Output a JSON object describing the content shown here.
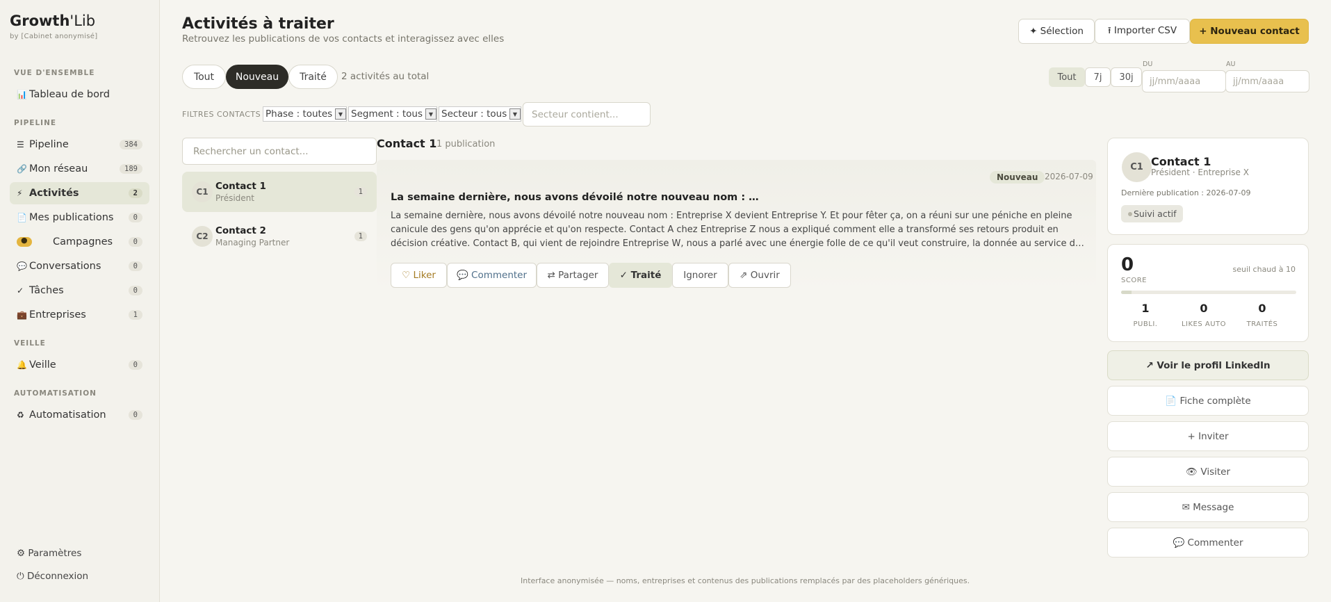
{
  "brand": {
    "name_bold": "Growth",
    "name_rest": "'Lib",
    "sub": "by [Cabinet anonymisé]"
  },
  "sidebar": {
    "sections": [
      "VUE D'ENSEMBLE",
      "PIPELINE",
      "VEILLE",
      "AUTOMATISATION"
    ],
    "items": [
      {
        "icon": "📊",
        "label": "Tableau de bord",
        "count": ""
      },
      {
        "icon": "☰",
        "label": "Pipeline",
        "count": "384"
      },
      {
        "icon": "🔗",
        "label": "Mon réseau",
        "count": "189"
      },
      {
        "icon": "⚡",
        "label": "Activités",
        "count": "2"
      },
      {
        "icon": "📄",
        "label": "Mes publications",
        "count": "0"
      },
      {
        "icon": "●",
        "label": "Campagnes",
        "count": "0"
      },
      {
        "icon": "💬",
        "label": "Conversations",
        "count": "0"
      },
      {
        "icon": "✓",
        "label": "Tâches",
        "count": "0"
      },
      {
        "icon": "💼",
        "label": "Entreprises",
        "count": "1"
      },
      {
        "icon": "🔔",
        "label": "Veille",
        "count": "0"
      },
      {
        "icon": "♻",
        "label": "Automatisation",
        "count": "0"
      }
    ],
    "footer": {
      "settings": "⚙ Paramètres",
      "logout": "⏻ Déconnexion"
    }
  },
  "header": {
    "title": "Activités à traiter",
    "subtitle": "Retrouvez les publications de vos contacts et interagissez avec elles",
    "btn_selection": "✦ Sélection",
    "btn_import": "⭱ Importer CSV",
    "btn_new": "+ Nouveau contact"
  },
  "tabs": [
    "Tout",
    "Nouveau",
    "Traité"
  ],
  "total_label": "2 activités au total",
  "range": {
    "options": [
      "Tout",
      "7j",
      "30j"
    ],
    "from_label": "DU",
    "to_label": "AU",
    "from_placeholder": "jj/mm/aaaa",
    "to_placeholder": "jj/mm/aaaa"
  },
  "filters": {
    "label": "FILTRES CONTACTS",
    "phase": "Phase : toutes",
    "segment": "Segment : tous",
    "secteur": "Secteur : tous",
    "secteur_placeholder": "Secteur contient..."
  },
  "contacts": {
    "search_placeholder": "Rechercher un contact...",
    "list": [
      {
        "initials": "C1",
        "name": "Contact 1",
        "role": "Président",
        "count": "1"
      },
      {
        "initials": "C2",
        "name": "Contact 2",
        "role": "Managing Partner",
        "count": "1"
      }
    ]
  },
  "detail": {
    "name": "Contact 1",
    "pub_count": "1 publication",
    "publication": {
      "status": "Nouveau",
      "date": "2026-07-09",
      "title": "La semaine dernière, nous avons dévoilé notre nouveau nom : …",
      "text": "La semaine dernière, nous avons dévoilé notre nouveau nom : Entreprise X devient Entreprise Y. Et pour fêter ça, on a réuni sur une péniche en pleine canicule des gens qu'on apprécie et qu'on respecte. Contact A chez Entreprise Z nous a expliqué comment elle a transformé ses retours produit en décision créative. Contact B, qui vient de rejoindre Entreprise W, nous a parlé avec une énergie folle de ce qu'il veut construire, la donnée au service d…",
      "actions": [
        "♡ Liker",
        "💬 Commenter",
        "⇄ Partager",
        "✓ Traité",
        "Ignorer",
        "⇗ Ouvrir"
      ]
    }
  },
  "profile": {
    "initials": "C1",
    "name": "Contact 1",
    "role": "Président · Entreprise X",
    "last_pub": "Dernière publication : 2026-07-09",
    "badge": "Suivi actif",
    "score": "0",
    "score_label": "SCORE",
    "threshold": "seuil chaud à 10",
    "score_fraction": 0.06,
    "stats": [
      {
        "value": "1",
        "label": "PUBLI."
      },
      {
        "value": "0",
        "label": "LIKES AUTO"
      },
      {
        "value": "0",
        "label": "TRAITÉS"
      }
    ],
    "buttons": [
      "↗ Voir le profil LinkedIn",
      "📄 Fiche complète",
      "+ Inviter",
      "👁 Visiter",
      "✉ Message",
      "💬 Commenter"
    ]
  },
  "footer_note": "Interface anonymisée — noms, entreprises et contenus des publications remplacés par des placeholders génériques."
}
